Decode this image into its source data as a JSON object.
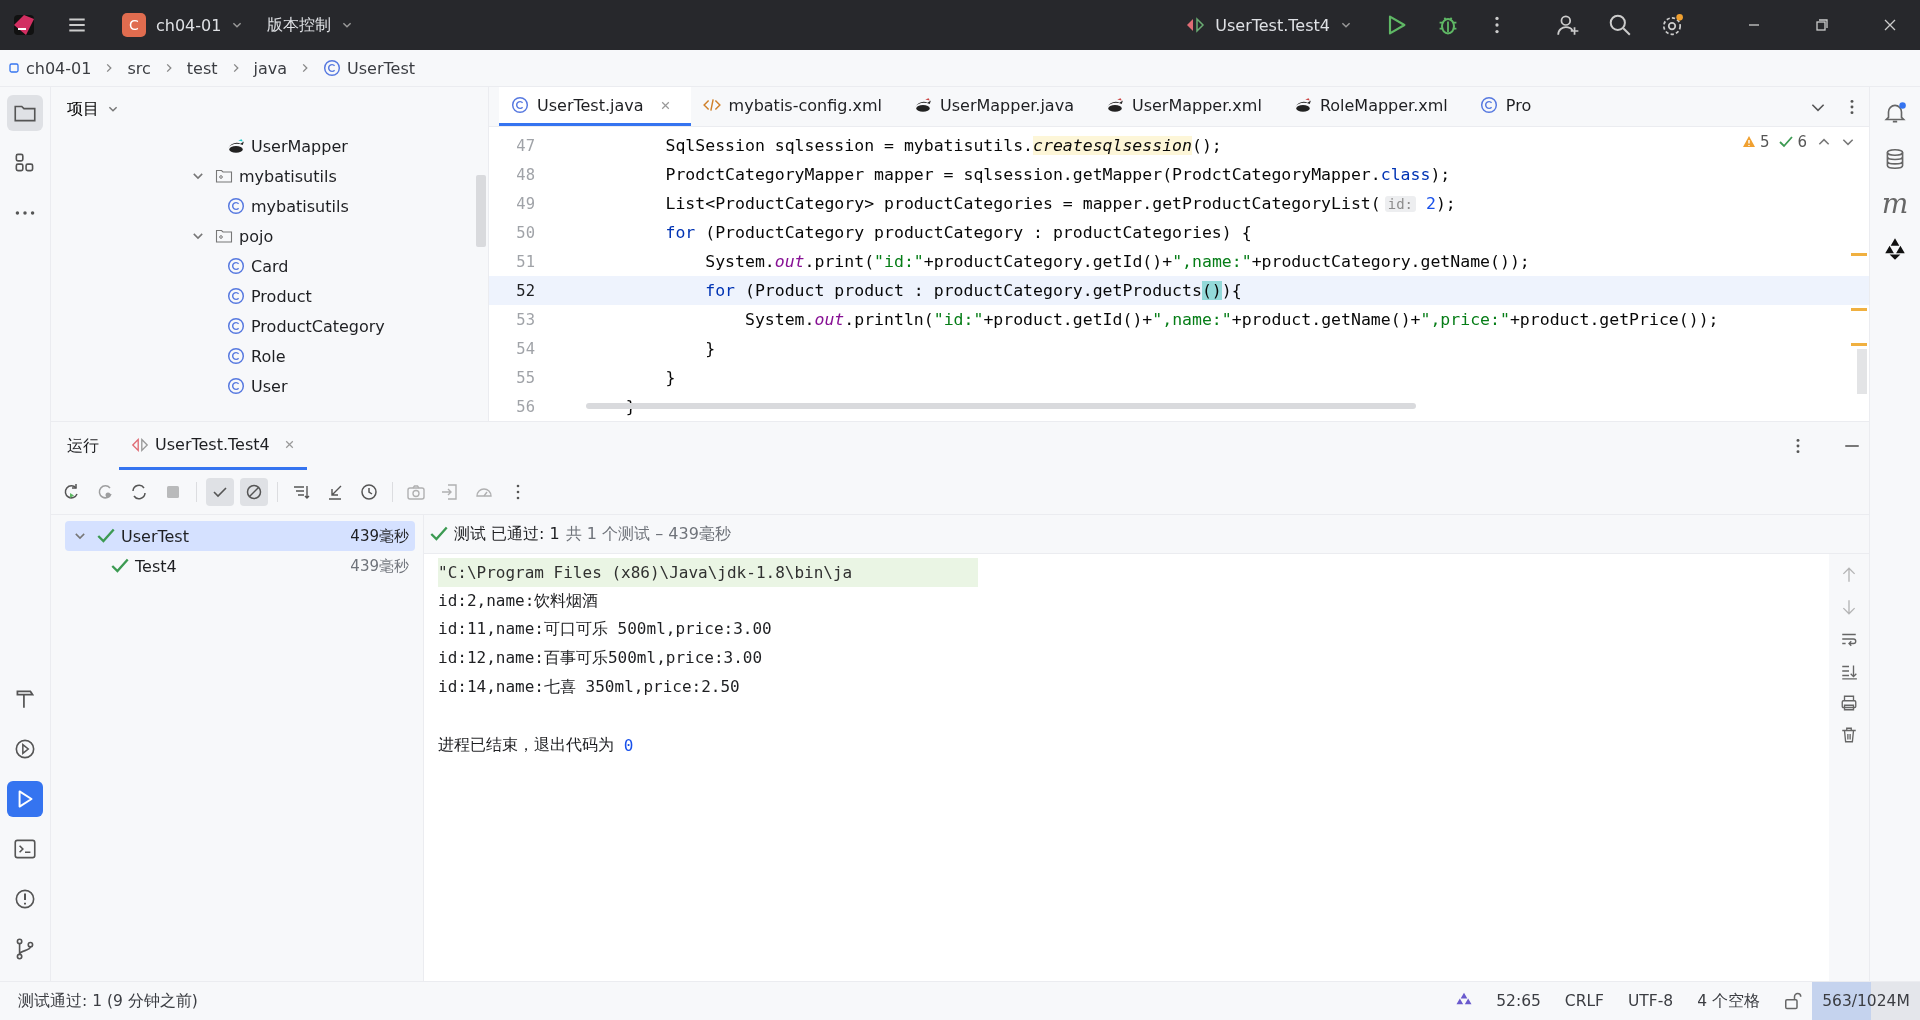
{
  "title_bar": {
    "project_badge": "C",
    "project": "ch04-01",
    "vcs": "版本控制",
    "run_config": "UserTest.Test4"
  },
  "breadcrumb": [
    "ch04-01",
    "src",
    "test",
    "java",
    "UserTest"
  ],
  "project_panel": {
    "title": "项目",
    "tree": [
      {
        "label": "UserMapper",
        "kind": "mapper"
      },
      {
        "label": "mybatisutils",
        "kind": "package",
        "expanded": true,
        "children": [
          {
            "label": "mybatisutils",
            "kind": "class"
          }
        ]
      },
      {
        "label": "pojo",
        "kind": "package",
        "expanded": true,
        "children": [
          {
            "label": "Card",
            "kind": "class"
          },
          {
            "label": "Product",
            "kind": "class"
          },
          {
            "label": "ProductCategory",
            "kind": "class"
          },
          {
            "label": "Role",
            "kind": "class"
          },
          {
            "label": "User",
            "kind": "class"
          }
        ]
      }
    ]
  },
  "editor_tabs": [
    {
      "label": "UserTest.java",
      "kind": "class",
      "selected": true
    },
    {
      "label": "mybatis-config.xml",
      "kind": "xml",
      "selected": false
    },
    {
      "label": "UserMapper.java",
      "kind": "mapper",
      "selected": false
    },
    {
      "label": "UserMapper.xml",
      "kind": "mapper",
      "selected": false
    },
    {
      "label": "RoleMapper.xml",
      "kind": "mapper",
      "selected": false
    },
    {
      "label": "Pro",
      "kind": "class",
      "selected": false
    }
  ],
  "inspections": {
    "warnings": "5",
    "passed": "6"
  },
  "code": [
    {
      "number": "47",
      "current": false,
      "tokens": [
        {
          "t": "        SqlSession sqlsession = mybatisutils.",
          "kind": "plain"
        },
        {
          "t": "createsqlsession",
          "kind": "static"
        },
        {
          "t": "();",
          "kind": "plain"
        }
      ]
    },
    {
      "number": "48",
      "current": false,
      "tokens": [
        {
          "t": "        ProdctCategoryMapper mapper = sqlsession.getMapper(ProdctCategoryMapper.",
          "kind": "plain"
        },
        {
          "t": "class",
          "kind": "keyword"
        },
        {
          "t": ");",
          "kind": "plain"
        }
      ]
    },
    {
      "number": "49",
      "current": false,
      "tokens": [
        {
          "t": "        List<ProductCategory> productCategories = mapper.getProductCategoryList(",
          "kind": "plain"
        },
        {
          "t": "id:",
          "kind": "hint"
        },
        {
          "t": " 2",
          "kind": "number"
        },
        {
          "t": ");",
          "kind": "plain"
        }
      ]
    },
    {
      "number": "50",
      "current": false,
      "tokens": [
        {
          "t": "        for",
          "kind": "keyword"
        },
        {
          "t": " (ProductCategory productCategory : productCategories) {",
          "kind": "plain"
        }
      ]
    },
    {
      "number": "51",
      "current": false,
      "tokens": [
        {
          "t": "            System.",
          "kind": "plain"
        },
        {
          "t": "out",
          "kind": "field"
        },
        {
          "t": ".print(",
          "kind": "plain"
        },
        {
          "t": "\"id:\"",
          "kind": "string"
        },
        {
          "t": "+productCategory.getId()+",
          "kind": "plain"
        },
        {
          "t": "\",name:\"",
          "kind": "string"
        },
        {
          "t": "+productCategory.getName());",
          "kind": "plain"
        }
      ]
    },
    {
      "number": "52",
      "current": true,
      "tokens": [
        {
          "t": "            for",
          "kind": "keyword"
        },
        {
          "t": " (Product product : productCategory.getProducts",
          "kind": "plain"
        },
        {
          "t": "()",
          "kind": "match"
        },
        {
          "t": "){",
          "kind": "plain"
        }
      ]
    },
    {
      "number": "53",
      "current": false,
      "tokens": [
        {
          "t": "                System.",
          "kind": "plain"
        },
        {
          "t": "out",
          "kind": "field"
        },
        {
          "t": ".println(",
          "kind": "plain"
        },
        {
          "t": "\"id:\"",
          "kind": "string"
        },
        {
          "t": "+product.getId()+",
          "kind": "plain"
        },
        {
          "t": "\",name:\"",
          "kind": "string"
        },
        {
          "t": "+product.getName()+",
          "kind": "plain"
        },
        {
          "t": "\",price:\"",
          "kind": "string"
        },
        {
          "t": "+product.getPrice());",
          "kind": "plain"
        }
      ]
    },
    {
      "number": "54",
      "current": false,
      "tokens": [
        {
          "t": "            }",
          "kind": "plain"
        }
      ]
    },
    {
      "number": "55",
      "current": false,
      "tokens": [
        {
          "t": "        }",
          "kind": "plain"
        }
      ]
    },
    {
      "number": "56",
      "current": false,
      "tokens": [
        {
          "t": "    }",
          "kind": "plain"
        }
      ]
    }
  ],
  "run_panel": {
    "title": "运行",
    "tabs": [
      {
        "label": "UserTest.Test4",
        "selected": true
      }
    ],
    "tree": [
      {
        "label": "UserTest",
        "time": "439毫秒",
        "selected": true,
        "expanded": true,
        "children": [
          {
            "label": "Test4",
            "time": "439毫秒",
            "selected": false
          }
        ]
      }
    ],
    "result": "测试 已通过: 1",
    "result_detail": "共 1 个测试 – 439毫秒",
    "console": [
      {
        "text": "\"C:\\Program Files (x86)\\Java\\jdk-1.8\\bin\\ja",
        "kind": "command"
      },
      {
        "text": "id:2,name:饮料烟酒",
        "kind": "output"
      },
      {
        "text": "id:11,name:可口可乐 500ml,price:3.00",
        "kind": "output"
      },
      {
        "text": "id:12,name:百事可乐500ml,price:3.00",
        "kind": "output"
      },
      {
        "text": "id:14,name:七喜 350ml,price:2.50",
        "kind": "output"
      },
      {
        "text": "进程已结束，退出代码为 ",
        "code": "0",
        "kind": "exit"
      }
    ]
  },
  "right_strip": {
    "maven_glyph": "m"
  },
  "status_bar": {
    "message": "测试通过: 1 (9 分钟之前)",
    "position": "52:65",
    "line_ending": "CRLF",
    "encoding": "UTF-8",
    "indent": "4 个空格",
    "memory": "563/1024M",
    "level": 0.55
  }
}
